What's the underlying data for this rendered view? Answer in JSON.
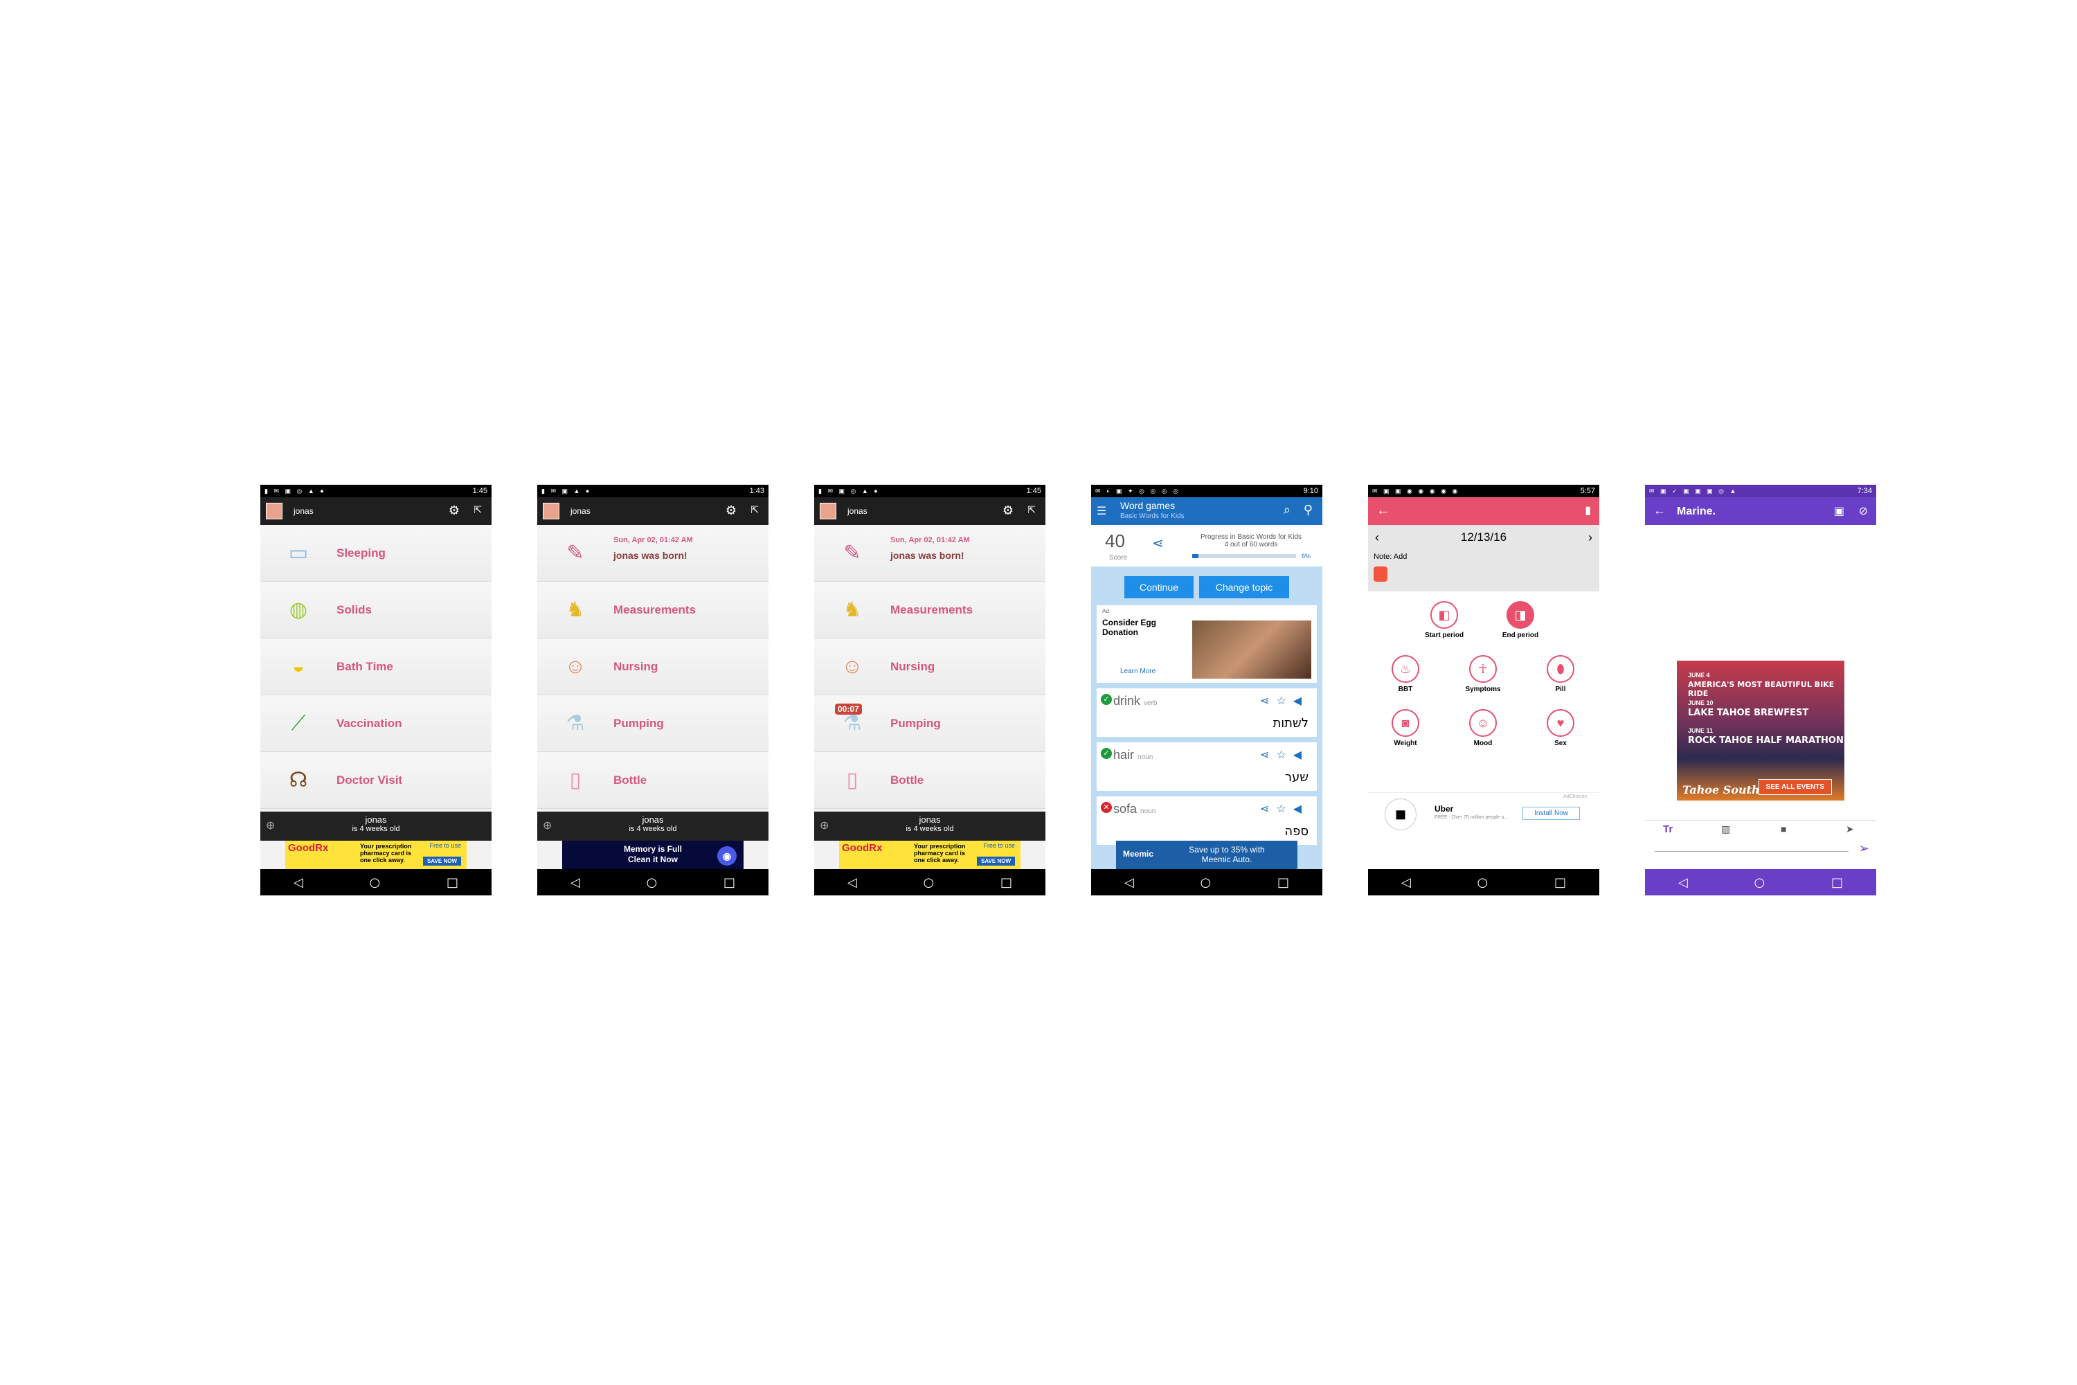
{
  "statusbar": {
    "s1": "1:45",
    "s2": "1:43",
    "s3": "1:45",
    "s4": "9:10",
    "s5": "5:57",
    "s6": "7:34"
  },
  "nav": {
    "back": "◁",
    "home": "○",
    "recent": "□"
  },
  "baby": {
    "name": "jonas",
    "age": "is 4 weeks old",
    "screen1_items": [
      "Sleeping",
      "Solids",
      "Bath Time",
      "Vaccination",
      "Doctor Visit"
    ],
    "born_date": "Sun, Apr 02, 01:42 AM",
    "born_text": "jonas was born!",
    "screen2_items": [
      "Measurements",
      "Nursing",
      "Pumping",
      "Bottle"
    ],
    "timer_badge": "00:07",
    "ad_goodrx": {
      "brand": "GoodRx",
      "text": "Your prescription pharmacy card is one click away.",
      "free": "Free to use",
      "button": "SAVE NOW"
    },
    "ad_memory": {
      "line1": "Memory is Full",
      "line2": "Clean it Now"
    }
  },
  "wordgames": {
    "title": "Word games",
    "subtitle": "Basic Words for Kids",
    "score": "40",
    "score_label": "Score",
    "progress_label": "Progress in Basic Words for Kids",
    "progress_count": "4 out of 60 words",
    "progress_pct": "6%",
    "btn_continue": "Continue",
    "btn_change": "Change topic",
    "ad_label": "Ad",
    "ad_title": "Consider Egg Donation",
    "ad_link": "Learn More",
    "cards": [
      {
        "word": "drink",
        "pos": "verb",
        "he": "לשתות",
        "status": "ok"
      },
      {
        "word": "hair",
        "pos": "noun",
        "he": "שער",
        "status": "ok"
      },
      {
        "word": "sofa",
        "pos": "noun",
        "he": "ספה",
        "status": "bad"
      }
    ],
    "bottom_ad_brand": "Meemic",
    "bottom_ad_text": "Save up to 35% with Meemic Auto."
  },
  "period": {
    "date": "12/13/16",
    "note": "Note: Add",
    "actions": [
      "Start period",
      "End period",
      "BBT",
      "Symptoms",
      "Pill",
      "Weight",
      "Mood",
      "Sex"
    ],
    "ad_label": "AdChoices",
    "ad_brand": "Uber",
    "ad_text": "FREE - Over 75 million people u...",
    "ad_button": "Install Now"
  },
  "marine": {
    "title": "Marine.",
    "ad_lines": [
      {
        "date": "JUNE 4",
        "event": "AMERICA'S MOST BEAUTIFUL BIKE RIDE"
      },
      {
        "date": "JUNE 10",
        "event": "LAKE TAHOE BREWFEST"
      },
      {
        "date": "JUNE 11",
        "event": "ROCK TAHOE HALF MARATHON"
      }
    ],
    "ad_brand": "Tahoe South",
    "ad_button": "SEE ALL EVENTS",
    "toolbar_text": "Tr"
  }
}
